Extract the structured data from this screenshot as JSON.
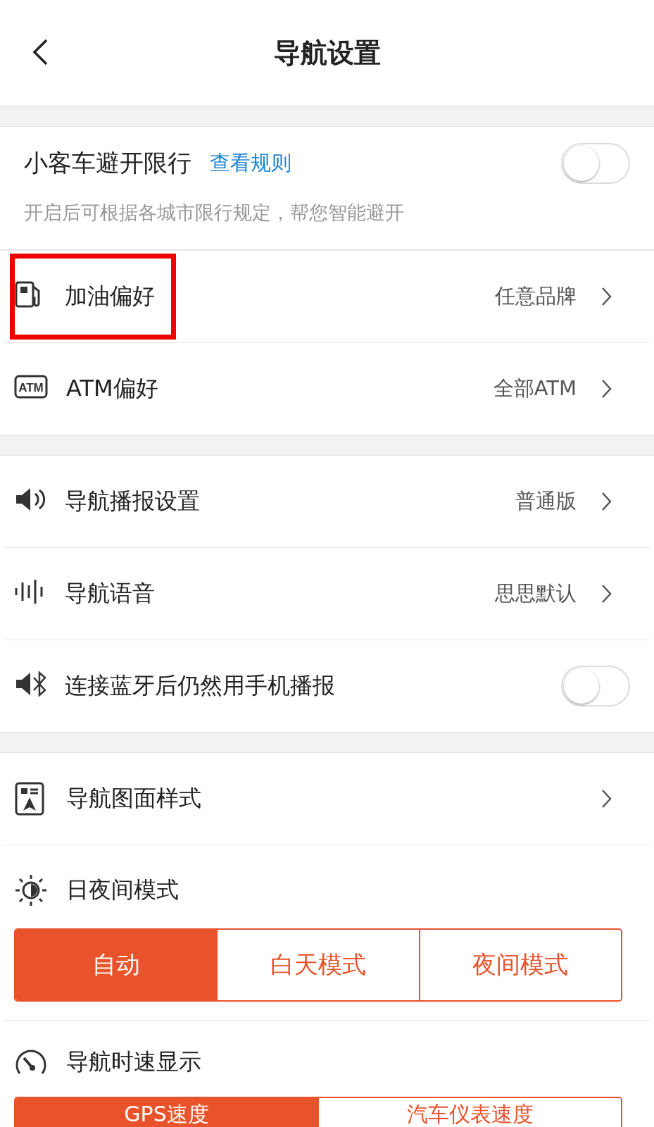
{
  "header": {
    "title": "导航设置"
  },
  "restriction": {
    "title": "小客车避开限行",
    "link": "查看规则",
    "on": false,
    "description": "开启后可根据各城市限行规定，帮您智能避开"
  },
  "groups": [
    [
      {
        "kind": "link",
        "label": "加油偏好",
        "value": "任意品牌",
        "highlighted": true
      },
      {
        "kind": "link",
        "icon_text": "ATM",
        "label": "ATM偏好",
        "value": "全部ATM",
        "highlighted": false
      }
    ],
    [
      {
        "kind": "link",
        "label": "导航播报设置",
        "value": "普通版",
        "highlighted": false
      },
      {
        "kind": "link",
        "label": "导航语音",
        "value": "思思默认",
        "highlighted": false
      },
      {
        "kind": "toggle",
        "label": "连接蓝牙后仍然用手机播报",
        "on": false,
        "highlighted": false
      }
    ],
    [
      {
        "kind": "link",
        "label": "导航图面样式",
        "highlighted": false
      },
      {
        "kind": "segmented",
        "label": "日夜间模式",
        "options": [
          {
            "label": "自动",
            "selected": true
          },
          {
            "label": "白天模式",
            "selected": false
          },
          {
            "label": "夜间模式",
            "selected": false
          }
        ]
      },
      {
        "kind": "segmented",
        "label": "导航时速显示",
        "options": [
          {
            "label": "GPS速度",
            "selected": true
          },
          {
            "label": "汽车仪表速度",
            "selected": false
          }
        ]
      }
    ]
  ]
}
